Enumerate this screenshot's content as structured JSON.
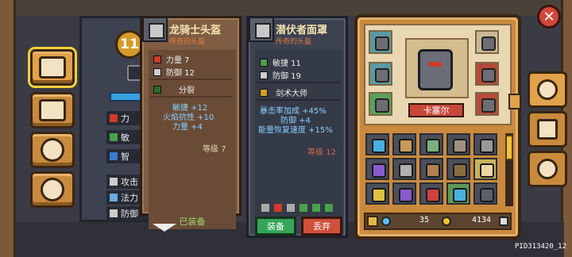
{
  "hero": {
    "level": "11",
    "name": "卡塞尔",
    "stats": [
      {
        "label": "力",
        "color": "#d13a2a"
      },
      {
        "label": "敏",
        "color": "#4aa04a"
      },
      {
        "label": "智",
        "color": "#3a7ad0"
      },
      {
        "label": "攻击",
        "color": "#cccccc"
      },
      {
        "label": "法力",
        "color": "#6aaae0"
      },
      {
        "label": "防御",
        "color": "#cccccc"
      }
    ]
  },
  "equipped_item": {
    "title": "龙骑士头盔",
    "rarity": "传奇的头盔",
    "lines": [
      {
        "label": "力量 7",
        "color": "#d13a2a"
      },
      {
        "label": "防御 12",
        "color": "#cccccc"
      }
    ],
    "skill": "分裂",
    "bonuses": [
      "敏捷 +12",
      "火焰抗性 +10",
      "力量 +4"
    ],
    "level": "等级 7",
    "status": "已装备"
  },
  "compared_item": {
    "title": "潜伏者面罩",
    "rarity": "传奇的头盔",
    "lines": [
      {
        "label": "敏捷 11",
        "color": "#4aa04a"
      },
      {
        "label": "防御 19",
        "color": "#cccccc"
      }
    ],
    "skill": "剑术大师",
    "bonuses": [
      "暴击率加成 +45%",
      "防御 +4",
      "能量恢复速度 +15%"
    ],
    "level": "等级 12",
    "equip_label": "装备",
    "discard_label": "丢弃"
  },
  "currency": {
    "gems": "35",
    "gold": "4134"
  },
  "footer_id": "PID313420_12",
  "inventory_colors": [
    "#4ab0e0",
    "#c89a5a",
    "#7ab080",
    "#a09080",
    "#999999",
    "#8a5ad0",
    "#b0b0b0",
    "#b08050",
    "#8a6a40",
    "#e8d8a0",
    "#e0c040",
    "#8a5ad0",
    "#d04040",
    "#4ab0e0",
    "#5a5f6a"
  ]
}
